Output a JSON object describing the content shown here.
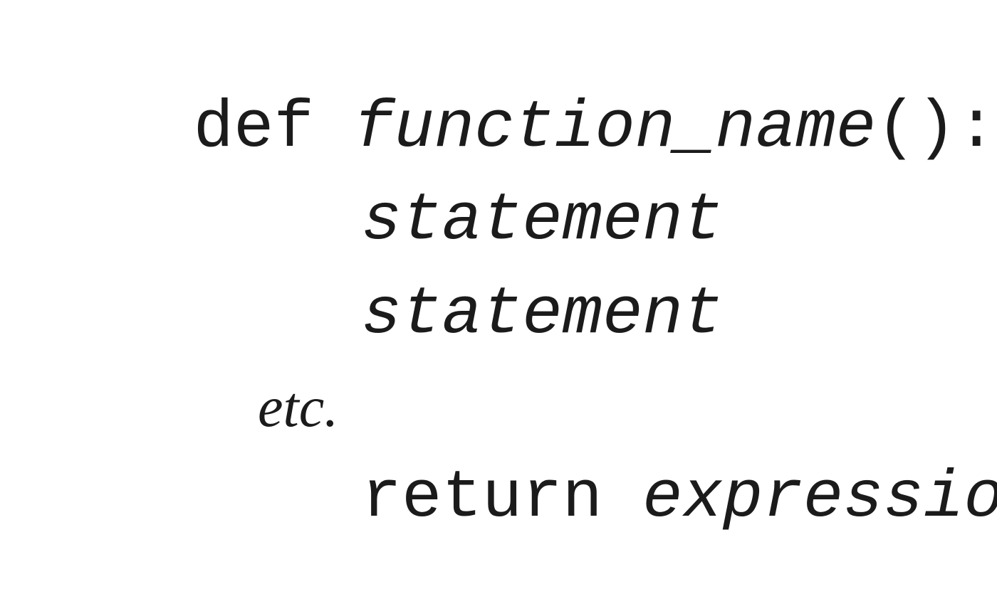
{
  "code": {
    "def_keyword": "def",
    "function_name": "function_name",
    "parens_colon": "():",
    "statement_1": "statement",
    "statement_2": "statement",
    "etc": "etc.",
    "return_keyword": "return",
    "return_expression": "expression"
  }
}
